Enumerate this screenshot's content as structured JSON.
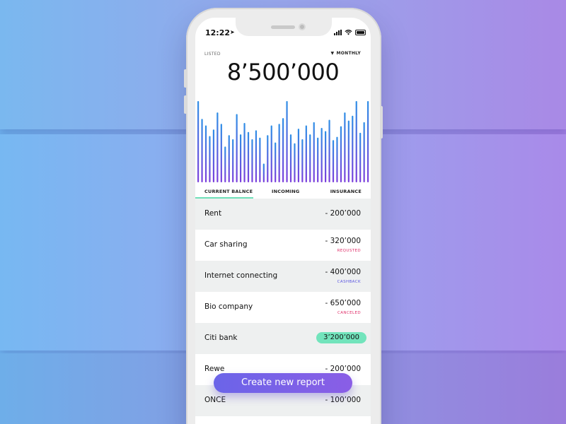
{
  "status_bar": {
    "time": "12:22"
  },
  "header": {
    "left_label": "LISTED",
    "period_label": "MONTHLY"
  },
  "balance": "8’500’000",
  "tabs": [
    {
      "label": "CURRENT BALNCE",
      "active": true
    },
    {
      "label": "INCOMING",
      "active": false
    },
    {
      "label": "INSURANCE",
      "active": false
    }
  ],
  "transactions": [
    {
      "title": "Rent",
      "amount": "- 200’000",
      "status": "",
      "status_color": ""
    },
    {
      "title": "Car sharing",
      "amount": "- 320’000",
      "status": "REQUSTED",
      "status_color": "#e0306a"
    },
    {
      "title": "Internet connecting",
      "amount": "- 400’000",
      "status": "CASHBACK",
      "status_color": "#5a55e0"
    },
    {
      "title": "Bio company",
      "amount": "- 650’000",
      "status": "CANCELED",
      "status_color": "#e0306a"
    },
    {
      "title": "Citi bank",
      "amount": "3’200’000",
      "status": "",
      "status_color": "",
      "highlight": true
    },
    {
      "title": "Rewe",
      "amount": "- 200’000",
      "status": "",
      "status_color": ""
    },
    {
      "title": "ONCE",
      "amount": "- 100’000",
      "status": "",
      "status_color": ""
    }
  ],
  "cta": {
    "label": "Create new report"
  },
  "colors": {
    "bar_top": "#2f8fe6",
    "bar_bottom": "#7b3fdc",
    "accent_tab": "#6ee0b8",
    "pill": "#72e4bc"
  },
  "chart_data": {
    "type": "bar",
    "values": [
      100,
      78,
      70,
      57,
      65,
      86,
      72,
      44,
      58,
      53,
      84,
      59,
      73,
      62,
      53,
      64,
      55,
      23,
      58,
      70,
      49,
      72,
      79,
      100,
      59,
      48,
      66,
      53,
      70,
      59,
      74,
      55,
      67,
      63,
      77,
      52,
      56,
      69,
      86,
      76,
      82,
      100,
      61,
      74,
      100
    ]
  }
}
